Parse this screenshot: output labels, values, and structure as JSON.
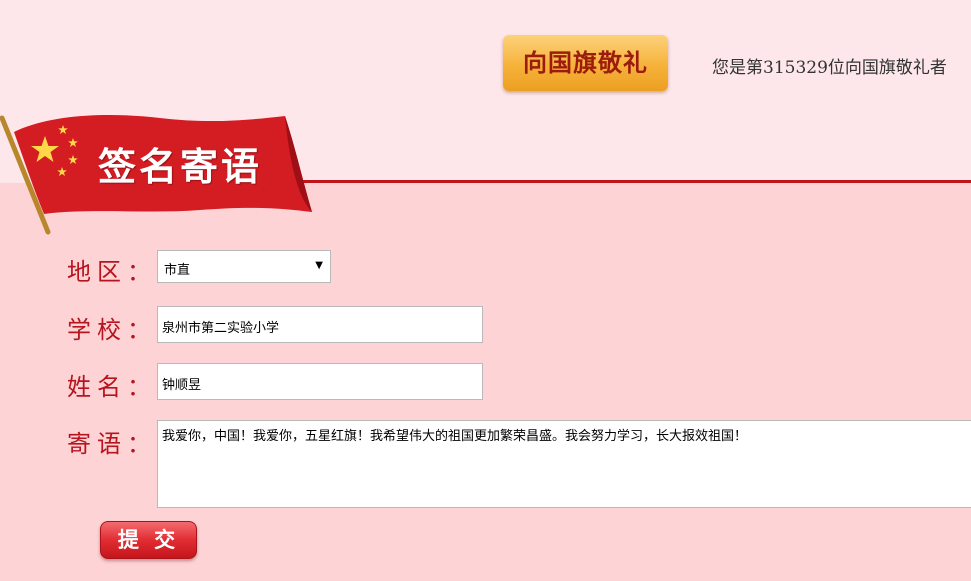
{
  "header": {
    "salute_button": "向国旗敬礼",
    "counter_text": "您是第315329位向国旗敬礼者"
  },
  "section": {
    "title": "签名寄语"
  },
  "form": {
    "region": {
      "label": "地区：",
      "value": "市直"
    },
    "school": {
      "label": "学校：",
      "value": "泉州市第二实验小学"
    },
    "name": {
      "label": "姓名：",
      "value": "钟顺昱"
    },
    "message": {
      "label": "寄语：",
      "value": "我爱你，中国！我爱你，五星红旗！我希望伟大的祖国更加繁荣昌盛。我会努力学习，长大报效祖国！"
    },
    "submit_label": "提 交"
  },
  "colors": {
    "accent_red": "#c0141a",
    "label_red": "#b7151e",
    "button_orange": "#f6b23a",
    "page_pink": "#fdd3d6"
  },
  "icons": [
    "flag-banner",
    "star-icon",
    "chevron-down-icon"
  ]
}
